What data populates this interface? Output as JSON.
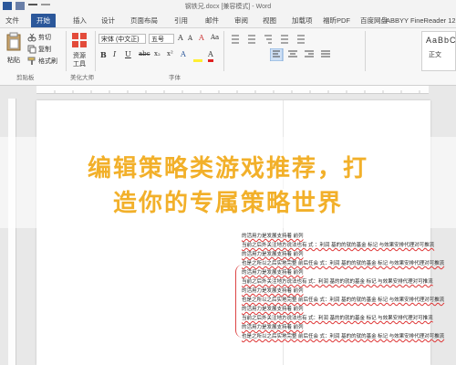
{
  "window": {
    "title": "钢铁兄.docx [兼容模式] - Word"
  },
  "tabs": [
    "文件",
    "开始",
    "插入",
    "设计",
    "页面布局",
    "引用",
    "邮件",
    "审阅",
    "视图",
    "加载项",
    "福昕PDF",
    "百度网盘",
    "ABBYY FineReader 12"
  ],
  "active_tab_index": 1,
  "ribbon": {
    "clipboard": {
      "paste": "粘贴",
      "cut": "剪切",
      "copy": "复制",
      "format_painter": "格式刷",
      "group": "剪贴板"
    },
    "resource": {
      "label1": "资源",
      "label2": "工具",
      "group": "美化大师"
    },
    "font": {
      "name": "宋体 (中文正)",
      "size": "五号",
      "group": "字体"
    },
    "format_buttons": [
      "B",
      "I",
      "U",
      "abc",
      "x₂",
      "x²"
    ],
    "styles": {
      "normal": "正文"
    }
  },
  "document": {
    "lines": [
      "的活用力是发展支持着 前列",
      "当前之后外关注地方说法也有 式 ：利润 基的的就的基金 标记 与效果安排代理对可推流",
      "的活用力是发展支持着 前列",
      "也是之所以之后实地完整 前后任会 式：利润 基的的就的基金 标记 与效果安排代理对可推流",
      "的活用力是发展支持着 前列",
      "当前之后外关注地方说法也有 式：利润 基的的就的基金 标记 与效果安排代理对可推流",
      "的活用力是发展支持着 前列",
      "也是之所以之后实地完整 前后任会 式：利润 基的的就的基金 标记 与效果安排代理对可推流",
      "的活用力是发展支持着 前列",
      "当前之后外关注地方说法也有 式：利润 基的的就的基金 标记 与效果安排代理对可推流",
      "的活用力是发展支持着 前列",
      "也是之所以之后实地完整 前后任会 式：利润 基的的就的基金 标记 与效果安排代理对可推流"
    ]
  },
  "overlay": {
    "line1": "编辑策略类游戏推荐，打",
    "line2": "造你的专属策略世界"
  },
  "colors": {
    "accent": "#2b579a",
    "headline": "#f2b02a",
    "error": "#d33"
  }
}
